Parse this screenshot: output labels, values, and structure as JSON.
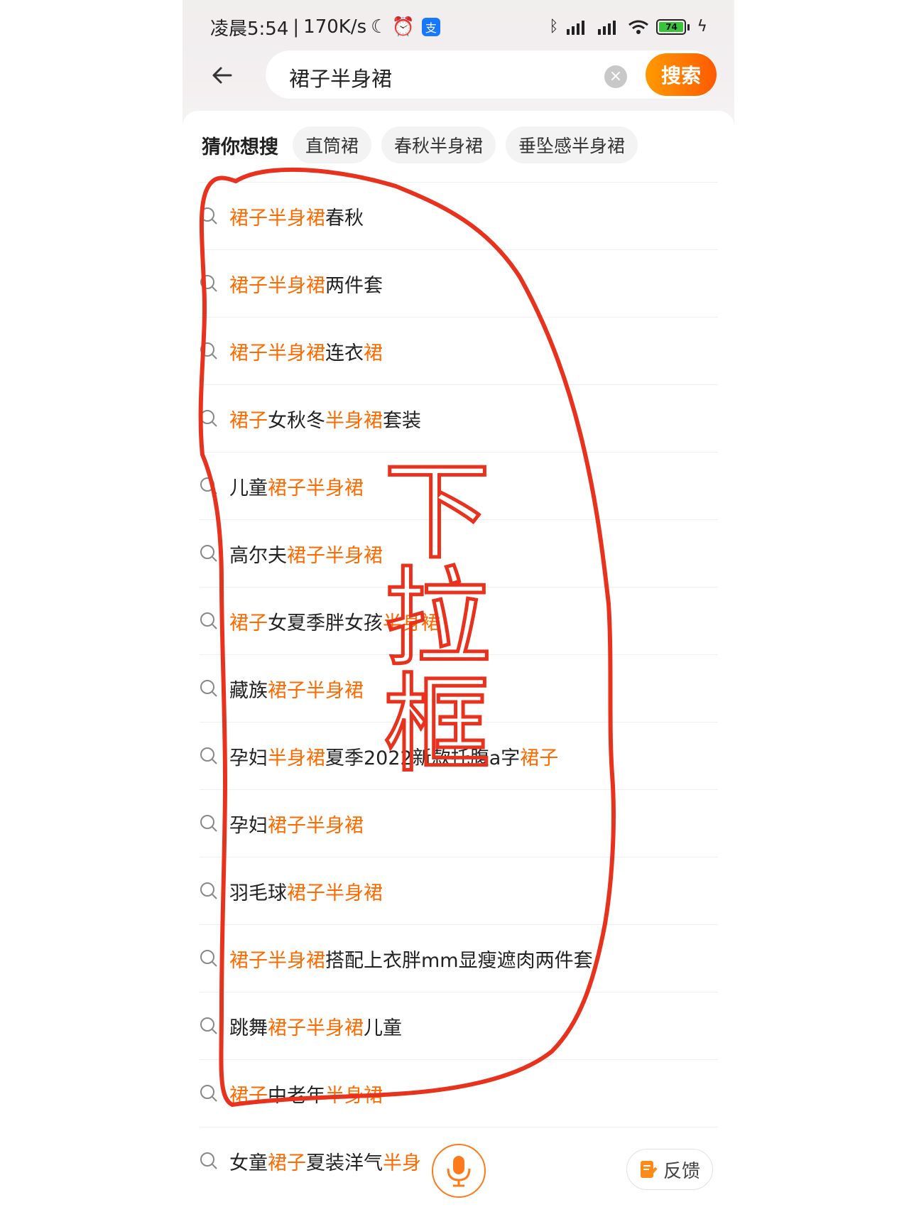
{
  "status_bar": {
    "time": "凌晨5:54",
    "speed": "170K/s",
    "alipay": "支",
    "battery": "74"
  },
  "search": {
    "query": "裙子半身裙",
    "button_label": "搜索"
  },
  "guess": {
    "title": "猜你想搜",
    "chips": [
      "直筒裙",
      "春秋半身裙",
      "垂坠感半身裙"
    ]
  },
  "suggestions": [
    {
      "parts": [
        {
          "t": "裙子半身裙",
          "hl": true
        },
        {
          "t": "春秋",
          "hl": false
        }
      ]
    },
    {
      "parts": [
        {
          "t": "裙子半身裙",
          "hl": true
        },
        {
          "t": "两件套",
          "hl": false
        }
      ]
    },
    {
      "parts": [
        {
          "t": "裙子半身裙",
          "hl": true
        },
        {
          "t": "连衣",
          "hl": false
        },
        {
          "t": "裙",
          "hl": true
        }
      ]
    },
    {
      "parts": [
        {
          "t": "裙子",
          "hl": true
        },
        {
          "t": "女秋冬",
          "hl": false
        },
        {
          "t": "半身裙",
          "hl": true
        },
        {
          "t": "套装",
          "hl": false
        }
      ]
    },
    {
      "parts": [
        {
          "t": "儿童",
          "hl": false
        },
        {
          "t": "裙子半身裙",
          "hl": true
        }
      ]
    },
    {
      "parts": [
        {
          "t": "高尔夫",
          "hl": false
        },
        {
          "t": "裙子半身裙",
          "hl": true
        }
      ]
    },
    {
      "parts": [
        {
          "t": "裙子",
          "hl": true
        },
        {
          "t": "女夏季胖女孩",
          "hl": false
        },
        {
          "t": "半身裙",
          "hl": true
        }
      ]
    },
    {
      "parts": [
        {
          "t": "藏族",
          "hl": false
        },
        {
          "t": "裙子半身裙",
          "hl": true
        }
      ]
    },
    {
      "parts": [
        {
          "t": "孕妇",
          "hl": false
        },
        {
          "t": "半身裙",
          "hl": true
        },
        {
          "t": "夏季2022新款托腹a字",
          "hl": false
        },
        {
          "t": "裙子",
          "hl": true
        }
      ]
    },
    {
      "parts": [
        {
          "t": "孕妇",
          "hl": false
        },
        {
          "t": "裙子半身裙",
          "hl": true
        }
      ]
    },
    {
      "parts": [
        {
          "t": "羽毛球",
          "hl": false
        },
        {
          "t": "裙子半身裙",
          "hl": true
        }
      ]
    },
    {
      "parts": [
        {
          "t": "裙子半身裙",
          "hl": true
        },
        {
          "t": "搭配上衣胖mm显瘦遮肉两件套",
          "hl": false
        }
      ]
    },
    {
      "parts": [
        {
          "t": "跳舞",
          "hl": false
        },
        {
          "t": "裙子半身裙",
          "hl": true
        },
        {
          "t": "儿童",
          "hl": false
        }
      ]
    },
    {
      "parts": [
        {
          "t": "裙子",
          "hl": true
        },
        {
          "t": "中老年",
          "hl": false
        },
        {
          "t": "半身裙",
          "hl": true
        }
      ]
    },
    {
      "parts": [
        {
          "t": "女童",
          "hl": false
        },
        {
          "t": "裙子",
          "hl": true
        },
        {
          "t": "夏装洋气",
          "hl": false
        },
        {
          "t": "半身",
          "hl": true
        }
      ]
    }
  ],
  "feedback_label": "反馈",
  "annotation_text": "下拉框",
  "colors": {
    "highlight": "#ff6a00",
    "search_button": "#ff7a00",
    "annotation": "#e8321e"
  }
}
